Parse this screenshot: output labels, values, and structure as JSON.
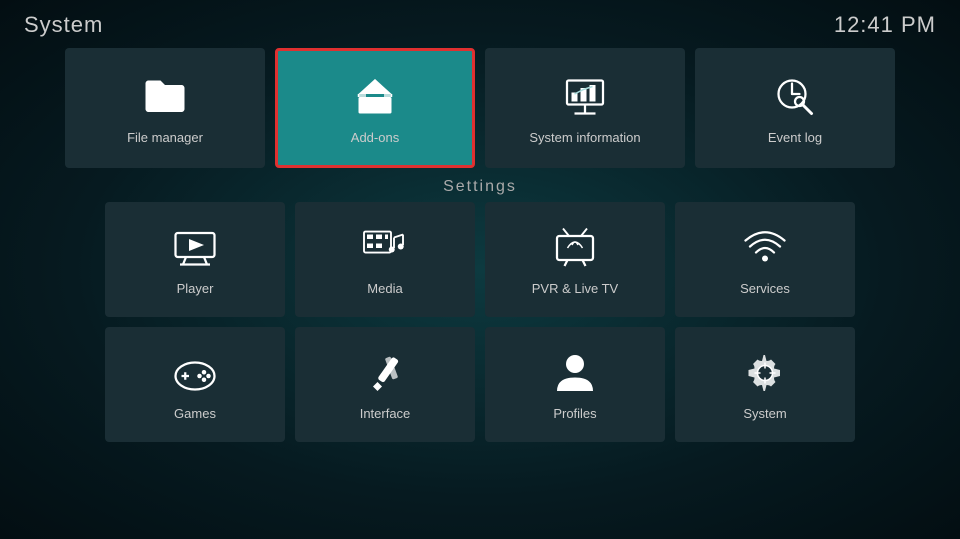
{
  "header": {
    "title": "System",
    "time": "12:41 PM"
  },
  "top_tiles": [
    {
      "id": "file-manager",
      "label": "File manager",
      "icon": "folder",
      "highlighted": false
    },
    {
      "id": "add-ons",
      "label": "Add-ons",
      "icon": "addons",
      "highlighted": true
    },
    {
      "id": "system-information",
      "label": "System information",
      "icon": "sysinfo",
      "highlighted": false
    },
    {
      "id": "event-log",
      "label": "Event log",
      "icon": "eventlog",
      "highlighted": false
    }
  ],
  "settings_label": "Settings",
  "settings_tiles": [
    {
      "id": "player",
      "label": "Player",
      "icon": "player"
    },
    {
      "id": "media",
      "label": "Media",
      "icon": "media"
    },
    {
      "id": "pvr-live-tv",
      "label": "PVR & Live TV",
      "icon": "pvr"
    },
    {
      "id": "services",
      "label": "Services",
      "icon": "services"
    },
    {
      "id": "games",
      "label": "Games",
      "icon": "games"
    },
    {
      "id": "interface",
      "label": "Interface",
      "icon": "interface"
    },
    {
      "id": "profiles",
      "label": "Profiles",
      "icon": "profiles"
    },
    {
      "id": "system",
      "label": "System",
      "icon": "system"
    }
  ]
}
